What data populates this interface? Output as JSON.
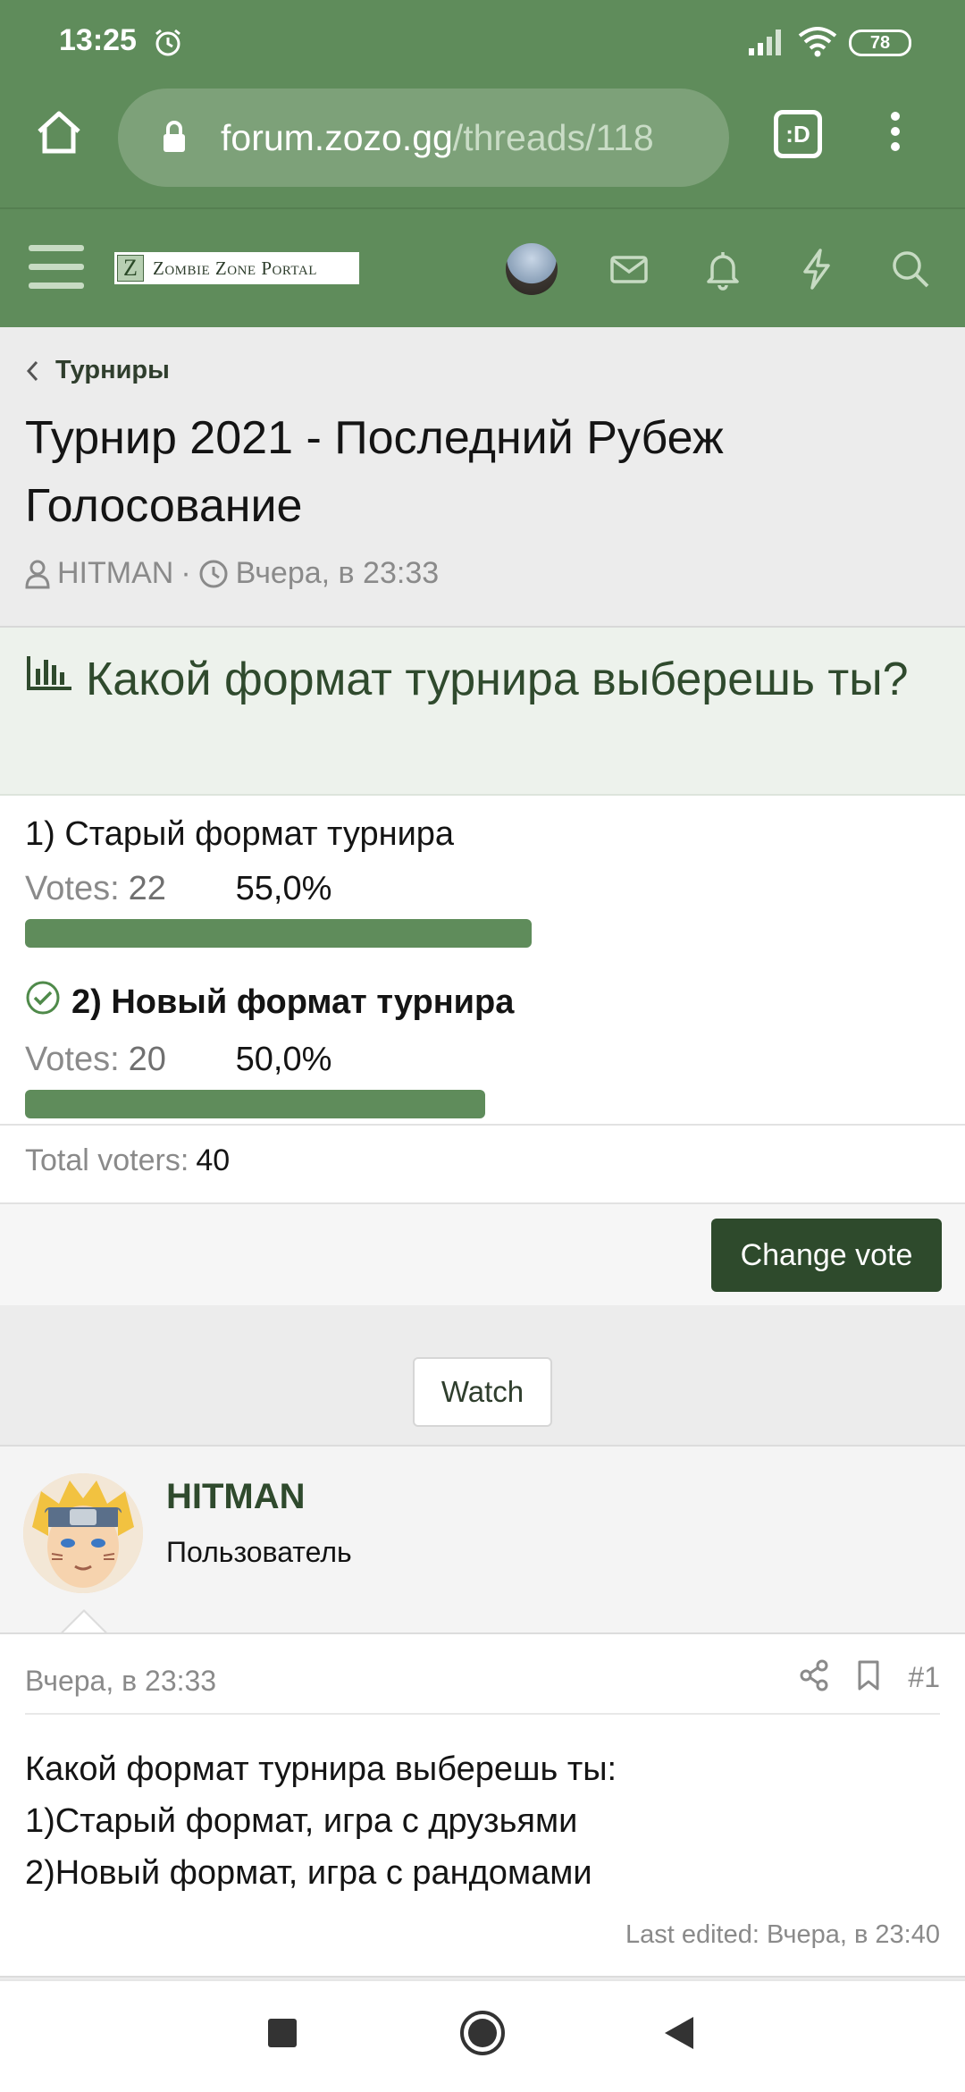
{
  "status_bar": {
    "time": "13:25",
    "battery": "78"
  },
  "browser": {
    "url_host": "forum.zozo.gg",
    "url_path": "/threads/118",
    "tabs_label": ":D"
  },
  "forum_header": {
    "logo_letter": "Z",
    "logo_text": "Zombie Zone Portal"
  },
  "breadcrumb": {
    "label": "Турниры"
  },
  "thread": {
    "title": "Турнир 2021 - Последний Рубеж Голосование",
    "author": "HITMAN",
    "separator": "·",
    "date": "Вчера, в 23:33"
  },
  "poll": {
    "question": "Какой формат турнира выберешь ты?",
    "votes_label": "Votes:",
    "options": [
      {
        "label": "1) Старый формат турнира",
        "votes": "22",
        "percent": "55,0%",
        "fill": 55,
        "voted": false
      },
      {
        "label": "2) Новый формат турнира",
        "votes": "20",
        "percent": "50,0%",
        "fill": 50,
        "voted": true
      }
    ],
    "total_label": "Total voters:",
    "total_value": "40",
    "change_vote_label": "Change vote"
  },
  "watch_label": "Watch",
  "post": {
    "username": "HITMAN",
    "role": "Пользователь",
    "date": "Вчера, в 23:33",
    "number": "#1",
    "lines": [
      "Какой формат турнира выберешь ты:",
      "1)Старый формат, игра с друзьями",
      "2)Новый формат, игра с рандомами"
    ],
    "last_edited": "Last edited: Вчера, в 23:40"
  },
  "colors": {
    "brand_green": "#5f8c5b",
    "dark_green": "#2e4a2c",
    "poll_header_bg": "#edf2ec"
  }
}
